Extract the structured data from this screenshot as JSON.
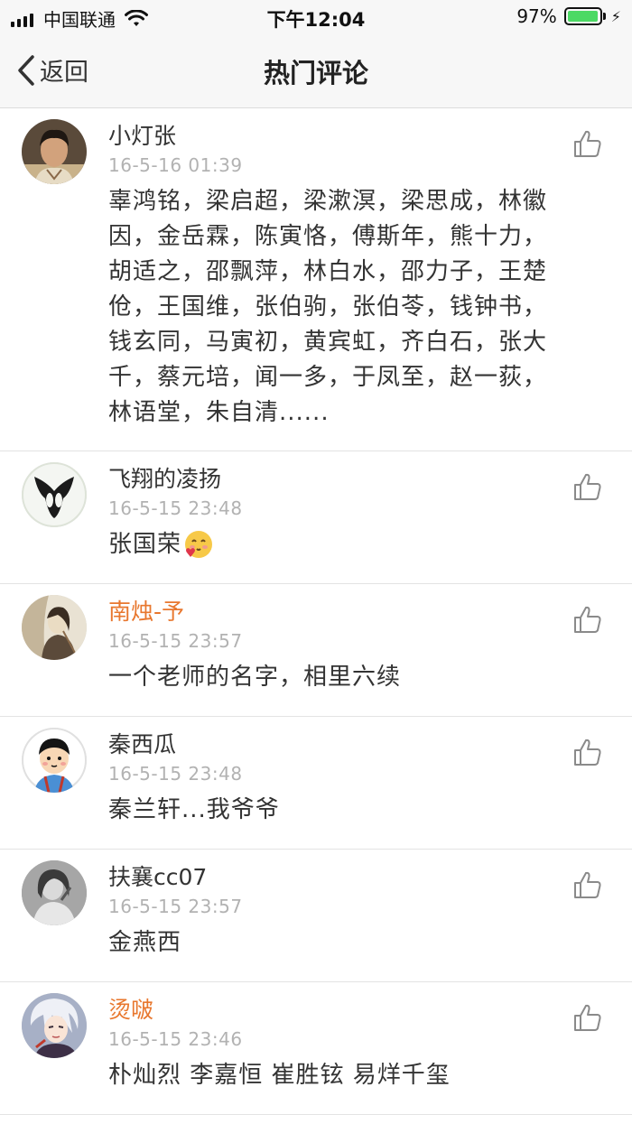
{
  "status_bar": {
    "carrier": "中国联通",
    "time": "下午12:04",
    "battery_percent": "97%",
    "battery_level": 0.97,
    "battery_color": "#4cd964"
  },
  "nav": {
    "back_label": "返回",
    "title": "热门评论"
  },
  "comments": [
    {
      "name": "小灯张",
      "name_color": "default",
      "time": "16-5-16 01:39",
      "text": "辜鸿铭，梁启超，梁漱溟，梁思成，林徽因，金岳霖，陈寅恪，傅斯年，熊十力，胡适之，邵飘萍，林白水，邵力子，王楚伧，王国维，张伯驹，张伯苓，钱钟书，钱玄同，马寅初，黄宾虹，齐白石，张大千，蔡元培，闻一多，于凤至，赵一荻，林语堂，朱自清......"
    },
    {
      "name": "飞翔的凌扬",
      "name_color": "default",
      "time": "16-5-15 23:48",
      "text": "张国荣",
      "emoji": "smile-heart-emoji"
    },
    {
      "name": "南烛-予",
      "name_color": "#e8772e",
      "time": "16-5-15 23:57",
      "text": "一个老师的名字，相里六续"
    },
    {
      "name": "秦西瓜",
      "name_color": "default",
      "time": "16-5-15 23:48",
      "text": "秦兰轩...我爷爷"
    },
    {
      "name": "扶襄cc07",
      "name_color": "default",
      "time": "16-5-15 23:57",
      "text": "金燕西"
    },
    {
      "name": "烫啵",
      "name_color": "#e8772e",
      "time": "16-5-15 23:46",
      "text": "朴灿烈 李嘉恒 崔胜铉 易烊千玺"
    }
  ]
}
